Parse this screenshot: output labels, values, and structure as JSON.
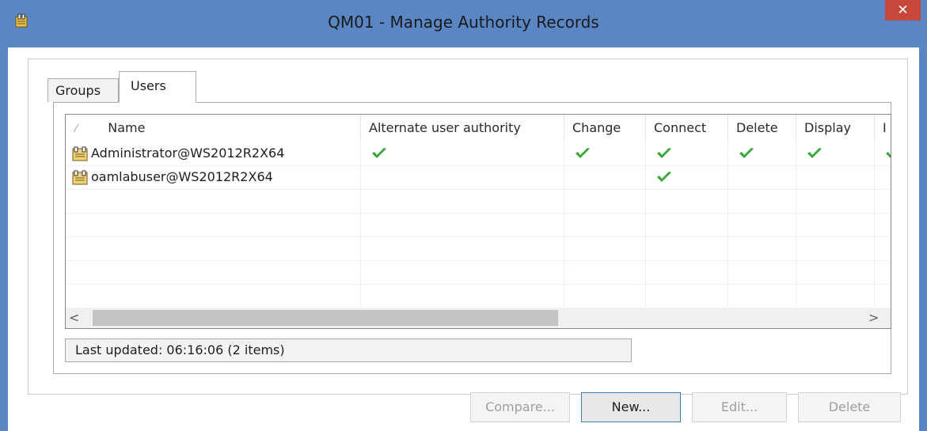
{
  "window": {
    "title": "QM01 - Manage Authority Records",
    "close_glyph": "✕",
    "icon": "folder-key-icon"
  },
  "tabs": [
    {
      "label": "Groups",
      "selected": false
    },
    {
      "label": "Users",
      "selected": true
    }
  ],
  "table": {
    "sort_glyph": "⁄",
    "columns": [
      "Name",
      "Alternate user authority",
      "Change",
      "Connect",
      "Delete",
      "Display",
      "I"
    ],
    "rows": [
      {
        "name": "Administrator@WS2012R2X64",
        "checks": [
          true,
          true,
          true,
          true,
          true,
          true
        ]
      },
      {
        "name": "oamlabuser@WS2012R2X64",
        "checks": [
          false,
          false,
          true,
          false,
          false,
          false
        ]
      }
    ],
    "row_icon": "user-icon",
    "check_icon": "check-icon",
    "check_color": "#3aa63a"
  },
  "scrollbar": {
    "left_glyph": "<",
    "right_glyph": ">"
  },
  "status": {
    "text": "Last updated: 06:16:06 (2 items)"
  },
  "buttons": {
    "compare": {
      "label": "Compare...",
      "enabled": false
    },
    "new": {
      "label": "New...",
      "enabled": true
    },
    "edit": {
      "label": "Edit...",
      "enabled": false
    },
    "delete": {
      "label": "Delete",
      "enabled": false
    }
  }
}
